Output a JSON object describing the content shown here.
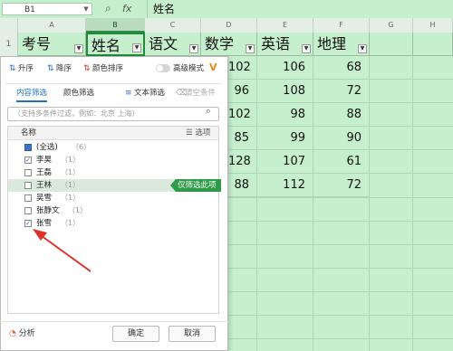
{
  "formula_bar": {
    "cell_ref": "B1",
    "fx_label": "fx",
    "content": "姓名"
  },
  "columns": [
    "A",
    "B",
    "C",
    "D",
    "E",
    "F",
    "G",
    "H"
  ],
  "rows": [
    "1"
  ],
  "header_row": [
    "考号",
    "姓名",
    "语文",
    "数学",
    "英语",
    "地理"
  ],
  "visible_data": [
    {
      "d": "102",
      "e": "106",
      "f": "68"
    },
    {
      "d": "96",
      "e": "108",
      "f": "72"
    },
    {
      "d": "102",
      "e": "98",
      "f": "88"
    },
    {
      "d": "85",
      "e": "99",
      "f": "90"
    },
    {
      "d": "128",
      "e": "107",
      "f": "61"
    },
    {
      "d": "88",
      "e": "112",
      "f": "72"
    }
  ],
  "filter_panel": {
    "sort_asc": "升序",
    "sort_desc": "降序",
    "sort_color": "颜色排序",
    "advanced_mode": "高级模式",
    "tab_content": "内容筛选",
    "tab_color": "颜色筛选",
    "text_filter": "文本筛选",
    "clear_condition": "清空条件",
    "search_placeholder": "（支持多条件过滤，例如：北京  上海）",
    "list_header": "名称",
    "options_label": "选项",
    "items": [
      {
        "name": "(全选)",
        "count": "（6）",
        "checked": "partial"
      },
      {
        "name": "李昊",
        "count": "（1）",
        "checked": true
      },
      {
        "name": "王磊",
        "count": "（1）",
        "checked": false
      },
      {
        "name": "王林",
        "count": "（1）",
        "checked": false
      },
      {
        "name": "吴雪",
        "count": "（1）",
        "checked": false
      },
      {
        "name": "张静文",
        "count": "（1）",
        "checked": false
      },
      {
        "name": "张雪",
        "count": "（1）",
        "checked": true
      }
    ],
    "only_filter_tag": "仅筛选此项",
    "analyze": "分析",
    "ok": "确定",
    "cancel": "取消"
  },
  "colors": {
    "sheet_bg": "#c6efce",
    "accent": "#2e9b48",
    "annotation_arrow": "#e0302a"
  }
}
